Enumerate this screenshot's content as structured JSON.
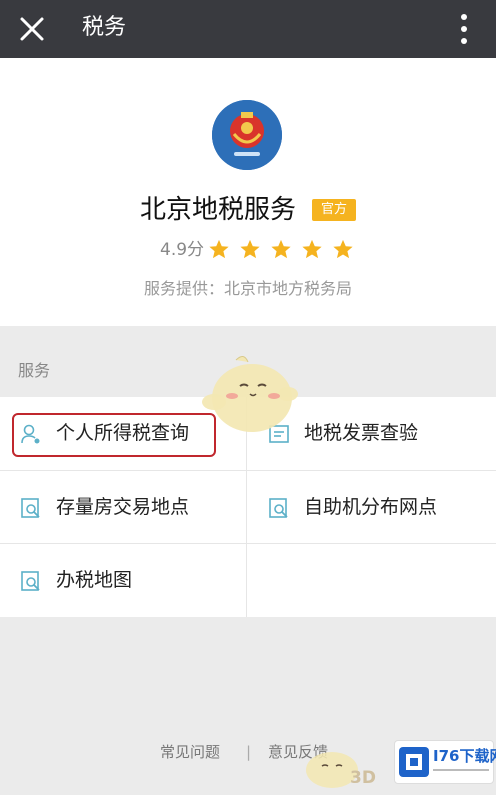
{
  "topbar": {
    "title": "税务",
    "close_icon": "close-icon",
    "more_icon": "more-vertical-icon",
    "bg": "#393a3f"
  },
  "profile": {
    "name": "北京地税服务",
    "badge": "官方",
    "badge_color": "#f5b31f",
    "rating": "4.9分",
    "stars": 5,
    "star_color": "#f5b31f",
    "provider": "服务提供：北京市地方税务局",
    "logo_color": "#2d6fb8"
  },
  "services": {
    "section_label": "服务",
    "items": [
      {
        "label": "个人所得税查询",
        "icon": "person-icon",
        "highlighted": true
      },
      {
        "label": "地税发票查验",
        "icon": "invoice-icon",
        "highlighted": false
      },
      {
        "label": "存量房交易地点",
        "icon": "search-document-icon",
        "highlighted": false
      },
      {
        "label": "自助机分布网点",
        "icon": "search-document-icon",
        "highlighted": false
      },
      {
        "label": "办税地图",
        "icon": "search-document-icon",
        "highlighted": false
      }
    ],
    "highlight_color": "#c0272d",
    "icon_color": "#5cb0c8"
  },
  "footer": {
    "faq": "常见问题",
    "separator": "|",
    "feedback": "意见反馈"
  },
  "watermarks": {
    "site_logo_text": "I76下载网",
    "mascot_3d": "3D"
  }
}
